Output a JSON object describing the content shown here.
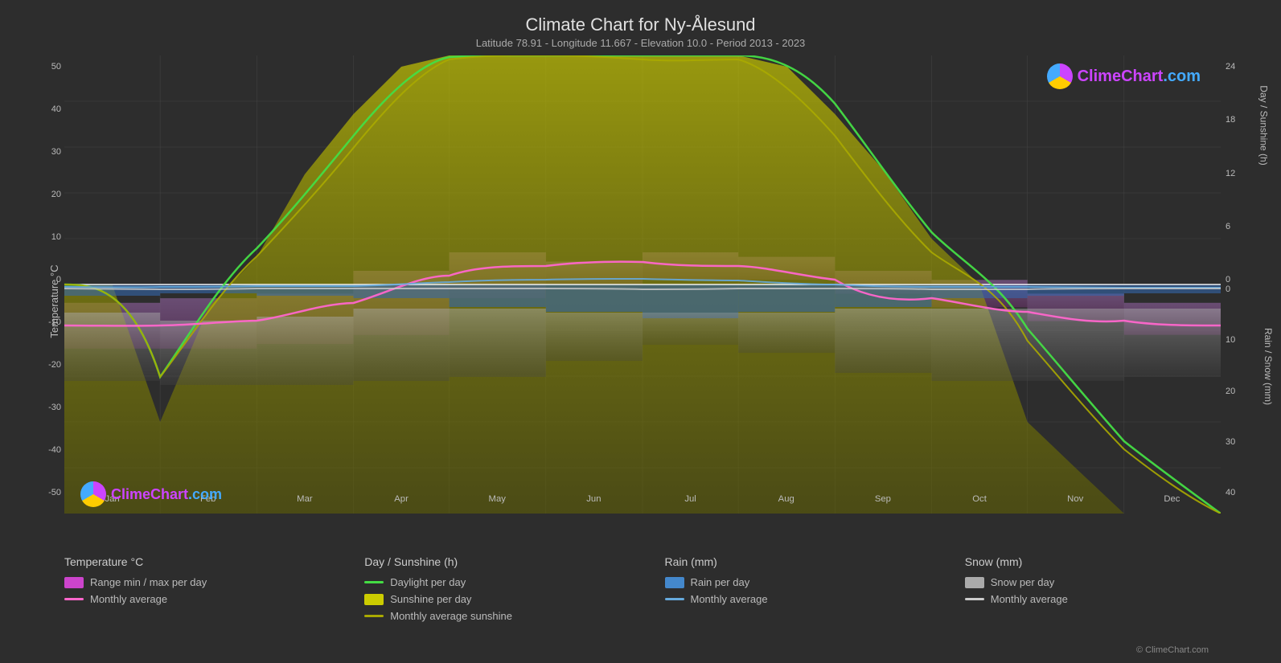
{
  "header": {
    "title": "Climate Chart for Ny-Ålesund",
    "subtitle": "Latitude 78.91 - Longitude 11.667 - Elevation 10.0 - Period 2013 - 2023"
  },
  "yaxis_left": {
    "label": "Temperature °C",
    "ticks": [
      "50",
      "40",
      "30",
      "20",
      "10",
      "0",
      "-10",
      "-20",
      "-30",
      "-40",
      "-50"
    ]
  },
  "yaxis_right_top": {
    "label": "Day / Sunshine (h)",
    "ticks": [
      "24",
      "18",
      "12",
      "6",
      "0"
    ]
  },
  "yaxis_right_bottom": {
    "label": "Rain / Snow (mm)",
    "ticks": [
      "0",
      "10",
      "20",
      "30",
      "40"
    ]
  },
  "xaxis": {
    "months": [
      "Jan",
      "Feb",
      "Mar",
      "Apr",
      "May",
      "Jun",
      "Jul",
      "Aug",
      "Sep",
      "Oct",
      "Nov",
      "Dec"
    ]
  },
  "legend": {
    "temperature": {
      "heading": "Temperature °C",
      "items": [
        {
          "type": "swatch",
          "color": "#cc44cc",
          "label": "Range min / max per day"
        },
        {
          "type": "line",
          "color": "#ff66cc",
          "label": "Monthly average"
        }
      ]
    },
    "sunshine": {
      "heading": "Day / Sunshine (h)",
      "items": [
        {
          "type": "line",
          "color": "#44cc44",
          "label": "Daylight per day"
        },
        {
          "type": "swatch",
          "color": "#cccc00",
          "label": "Sunshine per day"
        },
        {
          "type": "line",
          "color": "#aaaa00",
          "label": "Monthly average sunshine"
        }
      ]
    },
    "rain": {
      "heading": "Rain (mm)",
      "items": [
        {
          "type": "swatch",
          "color": "#4488cc",
          "label": "Rain per day"
        },
        {
          "type": "line",
          "color": "#66aadd",
          "label": "Monthly average"
        }
      ]
    },
    "snow": {
      "heading": "Snow (mm)",
      "items": [
        {
          "type": "swatch",
          "color": "#aaaaaa",
          "label": "Snow per day"
        },
        {
          "type": "line",
          "color": "#cccccc",
          "label": "Monthly average"
        }
      ]
    }
  },
  "logo": {
    "text_clime": "ClimeChart",
    "text_domain": ".com"
  },
  "copyright": "© ClimeChart.com"
}
